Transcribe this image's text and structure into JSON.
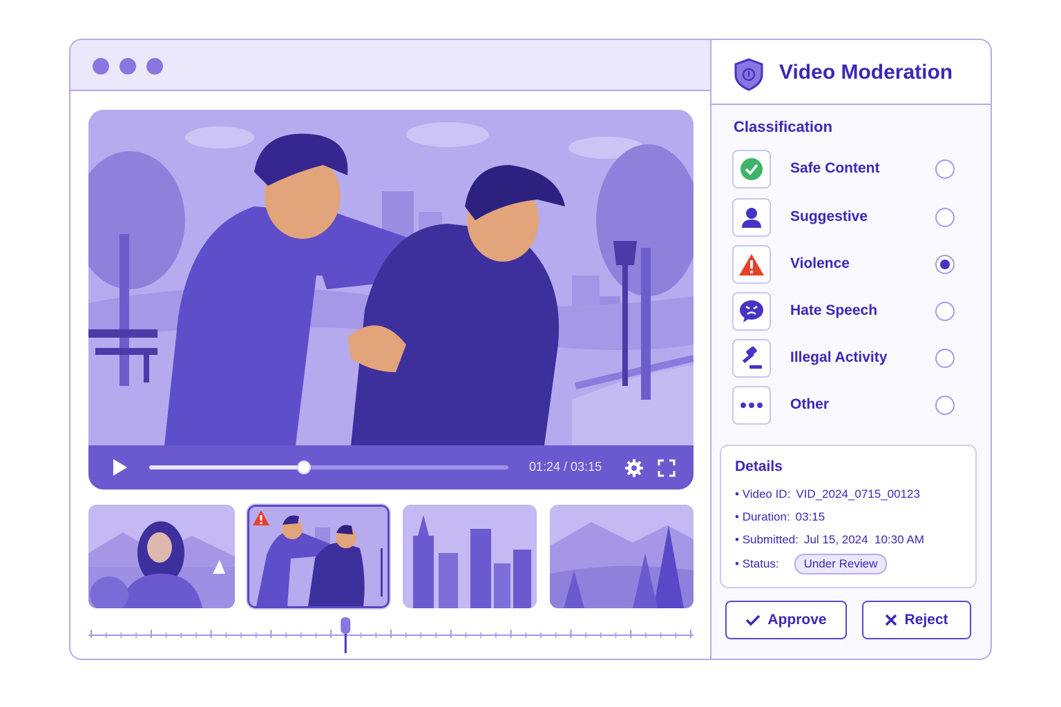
{
  "window": {
    "dots": [
      "dot",
      "dot",
      "dot"
    ]
  },
  "player": {
    "current_time": "01:24",
    "duration": "03:15",
    "time_display": "01:24 / 03:15",
    "progress_fraction": 0.43
  },
  "thumbnails": [
    {
      "scene": "blurred-woman-lakeside",
      "selected": false,
      "flagged": false
    },
    {
      "scene": "fight-in-park",
      "selected": true,
      "flagged": true
    },
    {
      "scene": "city-skyline",
      "selected": false,
      "flagged": false
    },
    {
      "scene": "mountains-forest",
      "selected": false,
      "flagged": false
    }
  ],
  "timeline": {
    "playhead_fraction": 0.425
  },
  "panel": {
    "title": "Video Moderation",
    "classification_title": "Classification",
    "options": [
      {
        "label": "Safe Content",
        "icon": "check-circle-icon",
        "color": "#3cb56a",
        "selected": false
      },
      {
        "label": "Suggestive",
        "icon": "person-icon",
        "color": "#4634c4",
        "selected": false
      },
      {
        "label": "Violence",
        "icon": "warning-triangle-icon",
        "color": "#e8402a",
        "selected": true
      },
      {
        "label": "Hate Speech",
        "icon": "angry-speech-bubble-icon",
        "color": "#4634c4",
        "selected": false
      },
      {
        "label": "Illegal Activity",
        "icon": "gavel-icon",
        "color": "#4634c4",
        "selected": false
      },
      {
        "label": "Other",
        "icon": "more-dots-icon",
        "color": "#4634c4",
        "selected": false
      }
    ],
    "details_title": "Details",
    "details": {
      "video_id_label": "Video ID:",
      "video_id": "VID_2024_0715_00123",
      "duration_label": "Duration:",
      "duration": "03:15",
      "submitted_label": "Submitted:",
      "submitted": "Jul 15, 2024  10:30 AM",
      "status_label": "Status:",
      "status": "Under Review"
    },
    "approve_label": "Approve",
    "reject_label": "Reject"
  },
  "colors": {
    "accent": "#3a28b8",
    "border": "#b8aaec",
    "violence": "#e8402a",
    "safe": "#3cb56a"
  }
}
